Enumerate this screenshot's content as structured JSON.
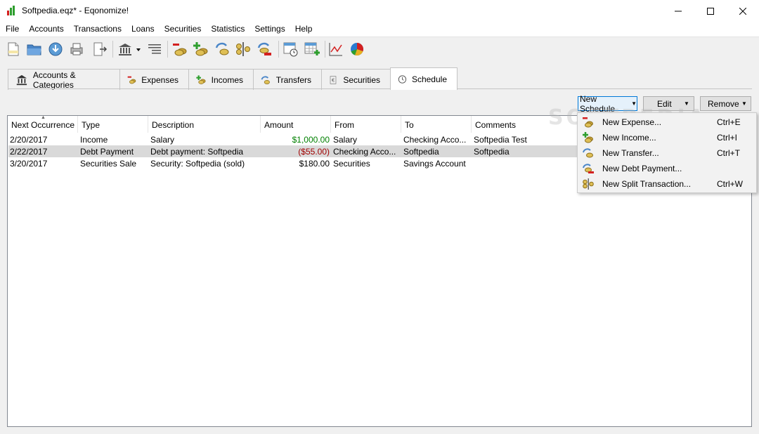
{
  "window": {
    "title": "Softpedia.eqz* - Eqonomize!"
  },
  "menu": [
    "File",
    "Accounts",
    "Transactions",
    "Loans",
    "Securities",
    "Statistics",
    "Settings",
    "Help"
  ],
  "toolbar": {
    "icons": [
      "new-file-icon",
      "open-folder-icon",
      "save-icon",
      "print-icon",
      "export-icon",
      "bank-account-icon",
      "dropdown-arrow-icon",
      "categories-icon",
      "new-expense-icon",
      "new-income-icon",
      "new-transfer-icon",
      "split-transaction-icon",
      "debt-payment-icon",
      "schedule-calendar-icon",
      "add-table-icon",
      "line-chart-icon",
      "pie-chart-icon"
    ]
  },
  "tabs": [
    {
      "label": "Accounts & Categories",
      "icon": "bank-icon",
      "active": false
    },
    {
      "label": "Expenses",
      "icon": "expense-icon",
      "active": false
    },
    {
      "label": "Incomes",
      "icon": "income-icon",
      "active": false
    },
    {
      "label": "Transfers",
      "icon": "transfer-icon",
      "active": false
    },
    {
      "label": "Securities",
      "icon": "securities-icon",
      "active": false
    },
    {
      "label": "Schedule",
      "icon": "clock-icon",
      "active": true
    }
  ],
  "buttons": {
    "new_schedule": "New Schedule",
    "edit": "Edit",
    "remove": "Remove"
  },
  "table": {
    "columns": [
      "Next Occurrence",
      "Type",
      "Description",
      "Amount",
      "From",
      "To",
      "Comments"
    ],
    "rows": [
      {
        "date": "2/20/2017",
        "type": "Income",
        "description": "Salary",
        "amount": "$1,000.00",
        "from": "Salary",
        "to": "Checking Acco...",
        "comments": "Softpedia Test",
        "amount_color": "#008000"
      },
      {
        "date": "2/22/2017",
        "type": "Debt Payment",
        "description": "Debt payment: Softpedia",
        "amount": "($55.00)",
        "from": "Checking Acco...",
        "to": "Softpedia",
        "comments": "Softpedia",
        "amount_color": "#a00000"
      },
      {
        "date": "3/20/2017",
        "type": "Securities Sale",
        "description": "Security: Softpedia (sold)",
        "amount": "$180.00",
        "from": "Securities",
        "to": "Savings Account",
        "comments": "",
        "amount_color": "#000000"
      }
    ]
  },
  "popup_menu": [
    {
      "label": "New Expense...",
      "shortcut": "Ctrl+E",
      "icon": "expense-icon"
    },
    {
      "label": "New Income...",
      "shortcut": "Ctrl+I",
      "icon": "income-icon"
    },
    {
      "label": "New Transfer...",
      "shortcut": "Ctrl+T",
      "icon": "transfer-icon"
    },
    {
      "label": "New Debt Payment...",
      "shortcut": "",
      "icon": "debt-payment-icon"
    },
    {
      "label": "New Split Transaction...",
      "shortcut": "Ctrl+W",
      "icon": "split-transaction-icon"
    }
  ],
  "watermark": "SOFTPEDIA"
}
